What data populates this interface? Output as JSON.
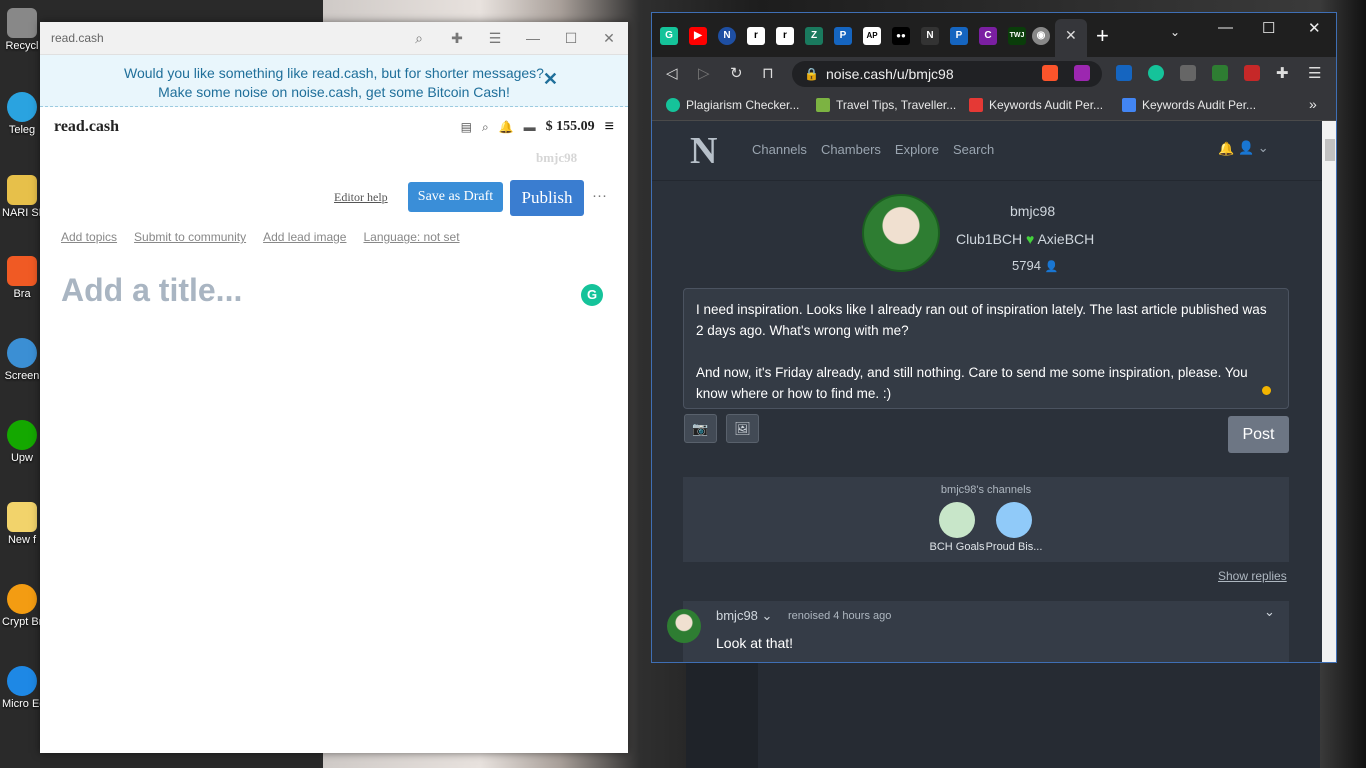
{
  "desktop": {
    "icons": [
      {
        "label": "Recycl",
        "color": "#888888"
      },
      {
        "label": "Teleg",
        "color": "#2aa3e0"
      },
      {
        "label": "NARI SECR",
        "color": "#e7c04a"
      },
      {
        "label": "Bra",
        "color": "#f05a24"
      },
      {
        "label": "Screen",
        "color": "#3b8fd4"
      },
      {
        "label": "Upw",
        "color": "#14a800"
      },
      {
        "label": "New f",
        "color": "#f2d36b"
      },
      {
        "label": "Crypt Brow",
        "color": "#f39c12"
      },
      {
        "label": "Micro Edg",
        "color": "#1e88e5"
      }
    ]
  },
  "left_window": {
    "title": "read.cash",
    "banner_line1": "Would you like something like read.cash, but for shorter messages?",
    "banner_line2": "Make some noise on noise.cash, get some Bitcoin Cash!",
    "banner_close": "✕",
    "brand": "read.cash",
    "balance": "$ 155.09",
    "username": "bmjc98",
    "editor_help": "Editor help",
    "save_draft": "Save as Draft",
    "publish": "Publish",
    "more": "···",
    "links": [
      "Add topics",
      "Submit to community",
      "Add lead image",
      "Language: not set"
    ],
    "title_placeholder": "Add a title..."
  },
  "right_window": {
    "tabs": [
      {
        "icon": "grammarly-tab-icon",
        "label": "G",
        "color": "#15c39a"
      },
      {
        "icon": "youtube-tab-icon",
        "label": "▶",
        "color": "#ff0000"
      },
      {
        "icon": "noise-tab-icon",
        "label": "N",
        "color": "#1e4fa3"
      },
      {
        "icon": "r-tab-icon",
        "label": "r",
        "color": "#ffffff"
      },
      {
        "icon": "r-tab-icon-2",
        "label": "r",
        "color": "#ffffff"
      },
      {
        "icon": "z-tab-icon",
        "label": "Z",
        "color": "#1a7a5e"
      },
      {
        "icon": "p-tab-icon",
        "label": "P",
        "color": "#1565c0"
      },
      {
        "icon": "ap-tab-icon",
        "label": "AP",
        "color": "#ffffff"
      },
      {
        "icon": "medium-tab-icon",
        "label": "●●",
        "color": "#000000"
      },
      {
        "icon": "n-tab-icon",
        "label": "N",
        "color": "#333333"
      },
      {
        "icon": "p-tab-icon-2",
        "label": "P",
        "color": "#1565c0"
      },
      {
        "icon": "c-tab-icon",
        "label": "C",
        "color": "#7b1fa2"
      },
      {
        "icon": "twj-tab-icon",
        "label": "TWJ",
        "color": "#0a3d0a"
      },
      {
        "icon": "globe-tab-icon",
        "label": "◉",
        "color": "#888888"
      }
    ],
    "url": "noise.cash/u/bmjc98",
    "bookmarks": [
      {
        "label": "Plagiarism Checker...",
        "color": "#15c39a"
      },
      {
        "label": "Travel Tips, Traveller...",
        "color": "#7cb342"
      },
      {
        "label": "Keywords Audit Per...",
        "color": "#e53935"
      },
      {
        "label": "Keywords Audit Per...",
        "color": "#4285f4"
      }
    ],
    "bookmarks_more": "»",
    "nav_links": [
      "Channels",
      "Chambers",
      "Explore",
      "Search"
    ],
    "profile": {
      "name": "bmjc98",
      "club1": "Club1BCH",
      "club2": "AxieBCH",
      "score": "5794"
    },
    "composer_text_1": "I need inspiration. Looks like I already ran out of inspiration lately. The last article published was 2 days ago. What's wrong with me?",
    "composer_text_2": "And now, it's Friday already, and still nothing. Care to send me some inspiration, please. You know where or how to find me. :)",
    "post_button": "Post",
    "channels_title": "bmjc98's channels",
    "channels": [
      {
        "label": "BCH Goals",
        "color": "#c8e6c9"
      },
      {
        "label": "Proud Bis...",
        "color": "#90caf9"
      }
    ],
    "show_replies": "Show replies",
    "feed": {
      "user": "bmjc98",
      "action": "renoised 4 hours ago",
      "text": "Look at that!"
    }
  }
}
